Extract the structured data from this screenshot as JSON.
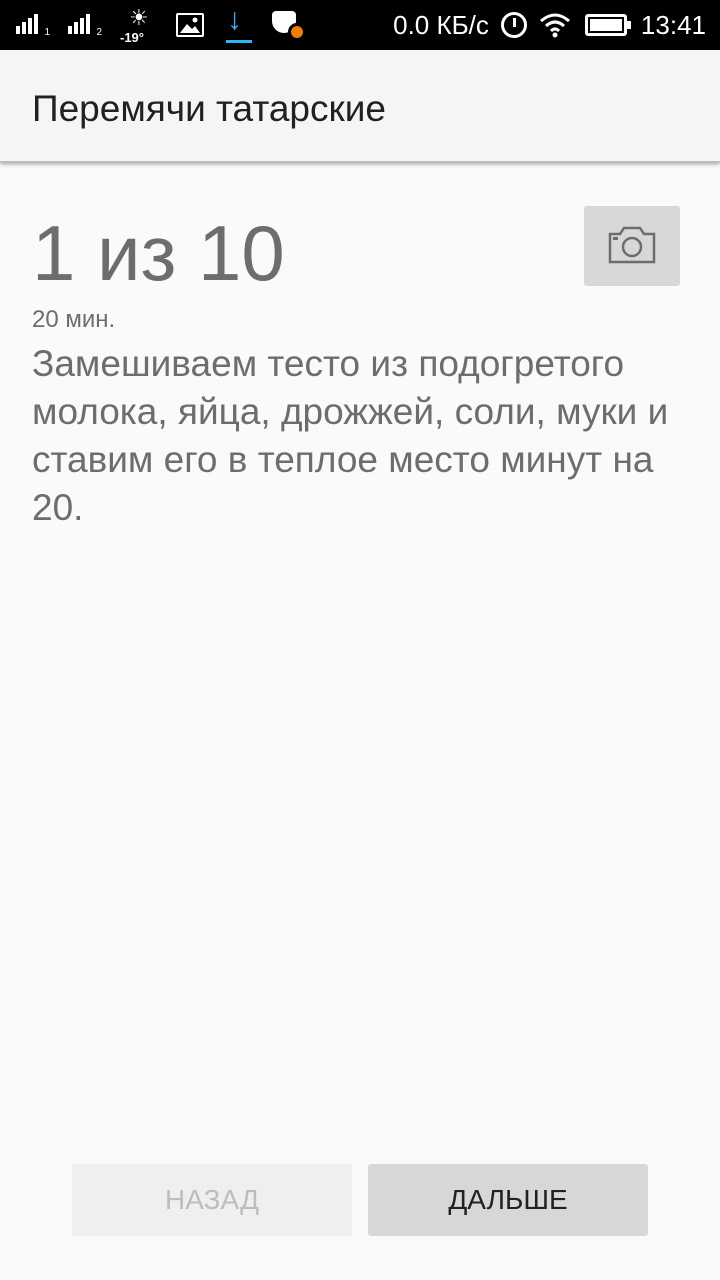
{
  "status_bar": {
    "sim1_label": "1",
    "sim2_label": "2",
    "weather_temp": "-19°",
    "weather_icon": "sun-icon",
    "gallery_icon": "image-icon",
    "download_icon": "download-icon",
    "app_notification_icon": "app-badge-icon",
    "network_speed": "0.0 КБ/с",
    "alarm_icon": "alarm-icon",
    "wifi_icon": "wifi-icon",
    "battery_icon": "battery-icon",
    "time": "13:41",
    "download_color": "#29b6f6",
    "app_badge_color": "#f57c00"
  },
  "app_bar": {
    "title": "Перемячи татарские"
  },
  "step": {
    "counter": "1 из 10",
    "duration": "20 мин.",
    "text": "Замешиваем тесто из подогретого молока, яйца, дрожжей, соли, муки и ставим его в теплое место минут на 20.",
    "photo_icon": "camera-icon"
  },
  "buttons": {
    "back_label": "Назад",
    "next_label": "Дальше"
  }
}
